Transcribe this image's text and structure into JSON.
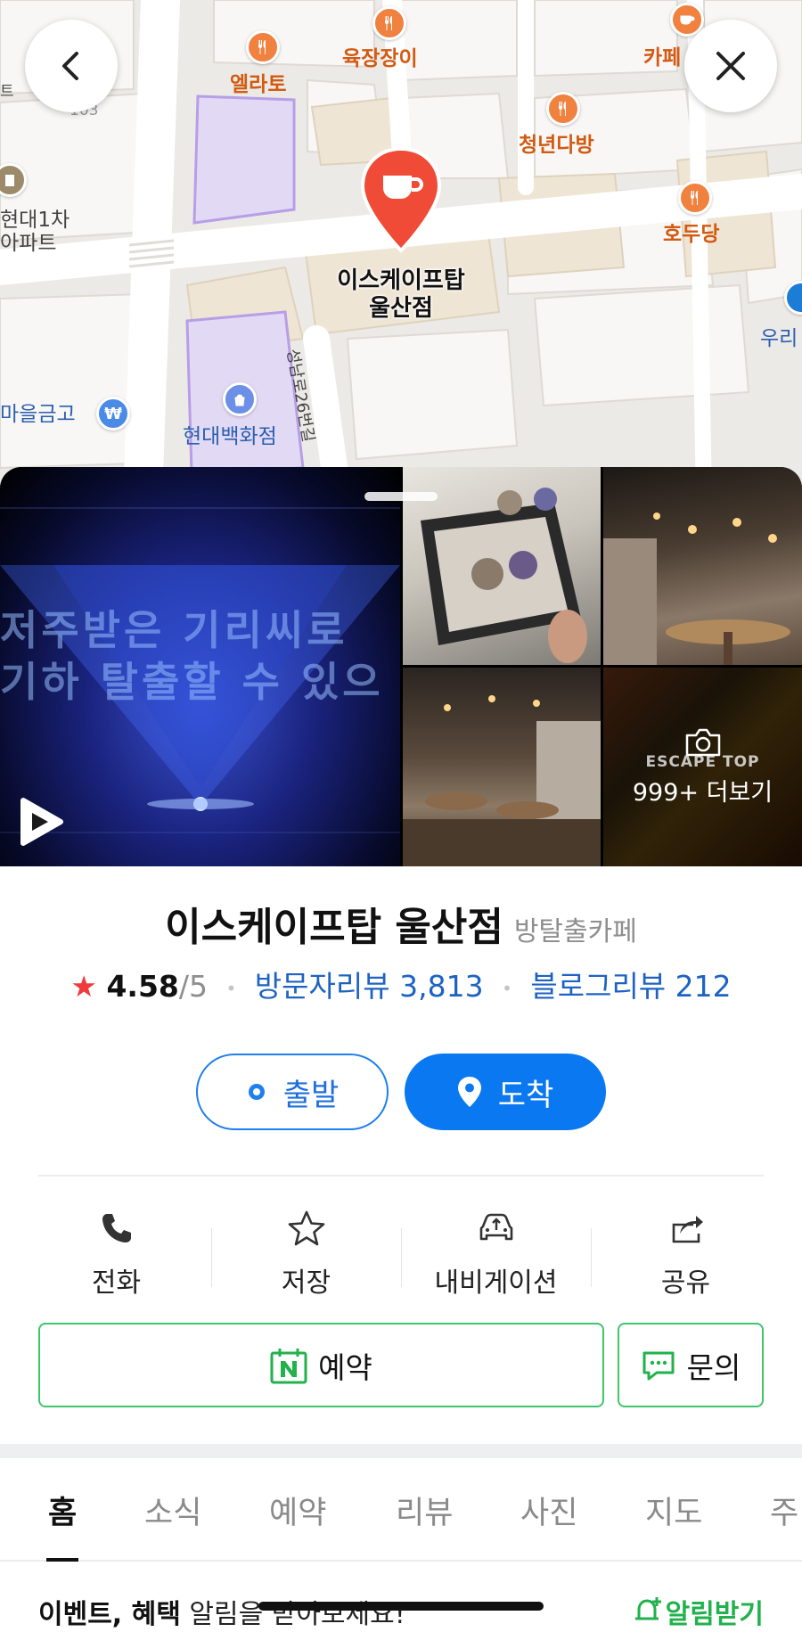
{
  "map": {
    "labels": {
      "yukjang": "육장장이",
      "cafe_partial": "카페",
      "ellato": "엘라토",
      "chungnyeon": "청년다방",
      "hodudang": "호두당",
      "hyundai_apt": "현대1차\n아파트",
      "building_no": "103",
      "maeul_bank": "마을금고",
      "hyundai_dept": "현대백화점",
      "street": "성남로26번길",
      "woori_partial": "우리",
      "edge_e": "트"
    },
    "place_pin_label": "이스케이프탑\n울산점"
  },
  "photos": {
    "video_text": "저주받은 기리씨로\n기하 탈출할 수 있으",
    "more_brand": "ESCAPE TOP",
    "more_label": "999+ 더보기"
  },
  "place": {
    "name": "이스케이프탑 울산점",
    "category": "방탈출카페",
    "rating": "4.58",
    "rating_max": "/5",
    "visitor_reviews": "방문자리뷰 3,813",
    "blog_reviews": "블로그리뷰 212"
  },
  "route": {
    "start_label": "출발",
    "end_label": "도착"
  },
  "actions": [
    {
      "label": "전화",
      "icon": "phone-icon"
    },
    {
      "label": "저장",
      "icon": "star-icon"
    },
    {
      "label": "내비게이션",
      "icon": "car-icon"
    },
    {
      "label": "공유",
      "icon": "share-icon"
    }
  ],
  "booking": {
    "book_label": "예약",
    "ask_label": "문의"
  },
  "tabs": [
    "홈",
    "소식",
    "예약",
    "리뷰",
    "사진",
    "지도",
    "주"
  ],
  "notice": {
    "bold": "이벤트, 혜택",
    "text": " 알림을 받아보세요!",
    "subscribe": "알림받기"
  },
  "colors": {
    "accent_blue": "#0a78f0",
    "naver_green": "#3fc56a",
    "pin_red": "#ef4b36",
    "food_orange": "#f0813f",
    "star_red": "#ef3b3b"
  }
}
